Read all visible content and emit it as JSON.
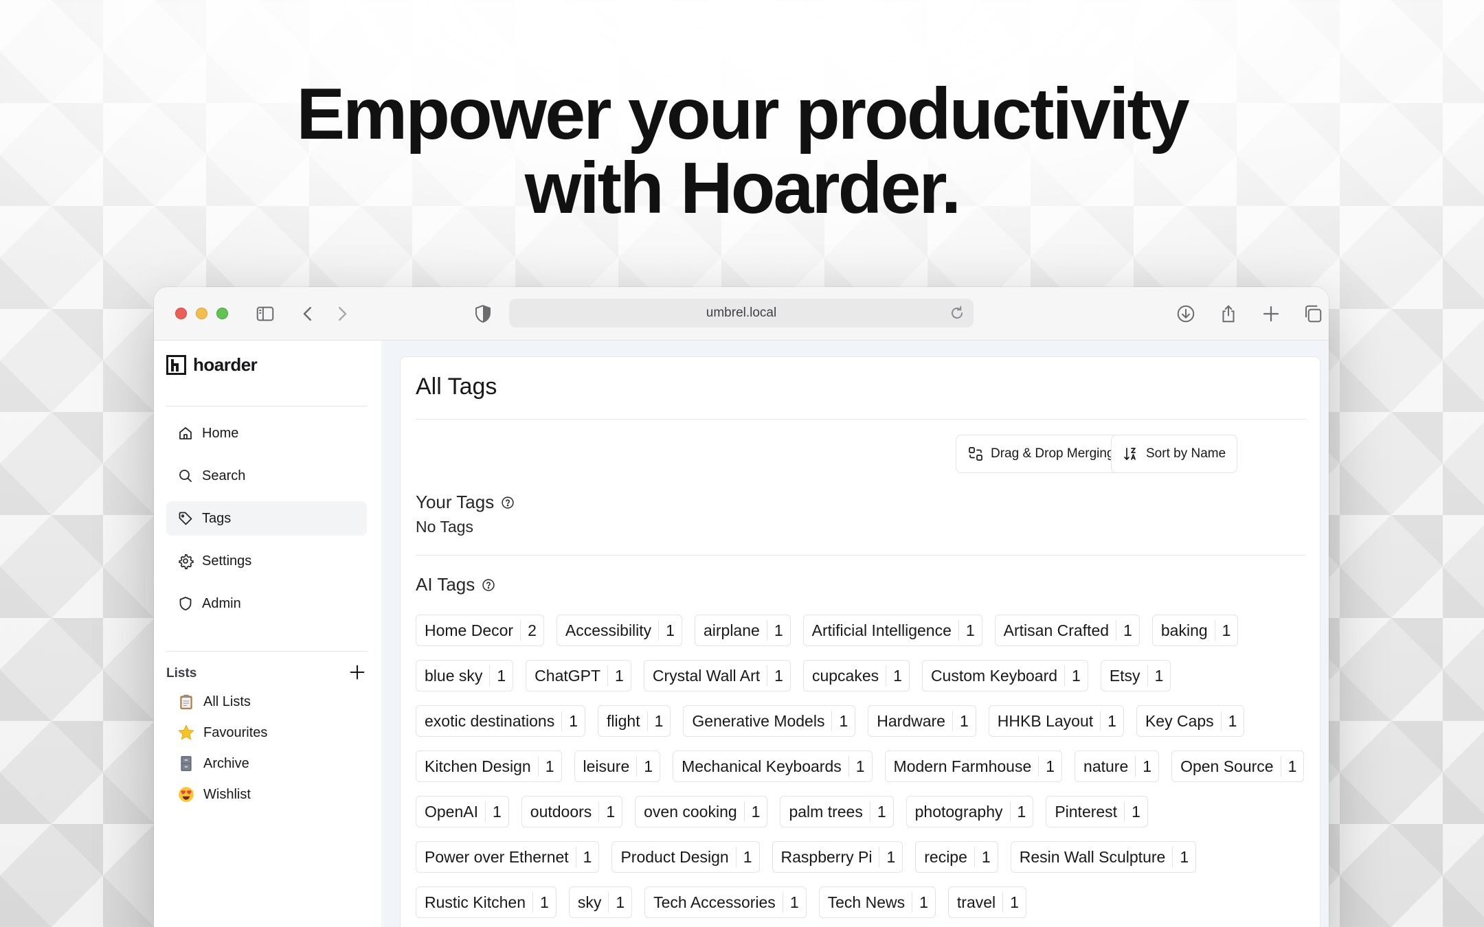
{
  "headline": {
    "line1": "Empower your productivity",
    "line2": "with Hoarder."
  },
  "browser": {
    "url": "umbrel.local",
    "toolbar_icons": [
      "sidebar-icon",
      "back-icon",
      "forward-icon",
      "shield-icon",
      "reload-icon",
      "download-icon",
      "share-icon",
      "new-tab-icon",
      "tabs-overview-icon"
    ]
  },
  "sidebar": {
    "logo_text": "hoarder",
    "nav": [
      {
        "label": "Home",
        "icon": "home-icon"
      },
      {
        "label": "Search",
        "icon": "search-icon"
      },
      {
        "label": "Tags",
        "icon": "tag-icon",
        "active": true
      },
      {
        "label": "Settings",
        "icon": "gear-icon"
      },
      {
        "label": "Admin",
        "icon": "shield-icon"
      }
    ],
    "lists_title": "Lists",
    "lists": [
      {
        "label": "All Lists",
        "icon": "clipboard-emoji-icon"
      },
      {
        "label": "Favourites",
        "icon": "star-emoji-icon"
      },
      {
        "label": "Archive",
        "icon": "file-cabinet-emoji-icon"
      },
      {
        "label": "Wishlist",
        "icon": "heart-eyes-emoji-icon"
      }
    ]
  },
  "main": {
    "title": "All Tags",
    "drag_drop_label": "Drag & Drop Merging",
    "sort_label": "Sort by Name",
    "your_tags_title": "Your Tags",
    "your_tags_empty": "No Tags",
    "ai_tags_title": "AI Tags",
    "ai_tags": [
      {
        "name": "Home Decor",
        "count": "2"
      },
      {
        "name": "Accessibility",
        "count": "1"
      },
      {
        "name": "airplane",
        "count": "1"
      },
      {
        "name": "Artificial Intelligence",
        "count": "1"
      },
      {
        "name": "Artisan Crafted",
        "count": "1"
      },
      {
        "name": "baking",
        "count": "1"
      },
      {
        "name": "blue sky",
        "count": "1"
      },
      {
        "name": "ChatGPT",
        "count": "1"
      },
      {
        "name": "Crystal Wall Art",
        "count": "1"
      },
      {
        "name": "cupcakes",
        "count": "1"
      },
      {
        "name": "Custom Keyboard",
        "count": "1"
      },
      {
        "name": "Etsy",
        "count": "1"
      },
      {
        "name": "exotic destinations",
        "count": "1"
      },
      {
        "name": "flight",
        "count": "1"
      },
      {
        "name": "Generative Models",
        "count": "1"
      },
      {
        "name": "Hardware",
        "count": "1"
      },
      {
        "name": "HHKB Layout",
        "count": "1"
      },
      {
        "name": "Key Caps",
        "count": "1"
      },
      {
        "name": "Kitchen Design",
        "count": "1"
      },
      {
        "name": "leisure",
        "count": "1"
      },
      {
        "name": "Mechanical Keyboards",
        "count": "1"
      },
      {
        "name": "Modern Farmhouse",
        "count": "1"
      },
      {
        "name": "nature",
        "count": "1"
      },
      {
        "name": "Open Source",
        "count": "1"
      },
      {
        "name": "OpenAI",
        "count": "1"
      },
      {
        "name": "outdoors",
        "count": "1"
      },
      {
        "name": "oven cooking",
        "count": "1"
      },
      {
        "name": "palm trees",
        "count": "1"
      },
      {
        "name": "photography",
        "count": "1"
      },
      {
        "name": "Pinterest",
        "count": "1"
      },
      {
        "name": "Power over Ethernet",
        "count": "1"
      },
      {
        "name": "Product Design",
        "count": "1"
      },
      {
        "name": "Raspberry Pi",
        "count": "1"
      },
      {
        "name": "recipe",
        "count": "1"
      },
      {
        "name": "Resin Wall Sculpture",
        "count": "1"
      },
      {
        "name": "Rustic Kitchen",
        "count": "1"
      },
      {
        "name": "sky",
        "count": "1"
      },
      {
        "name": "Tech Accessories",
        "count": "1"
      },
      {
        "name": "Tech News",
        "count": "1"
      },
      {
        "name": "travel",
        "count": "1"
      }
    ]
  }
}
